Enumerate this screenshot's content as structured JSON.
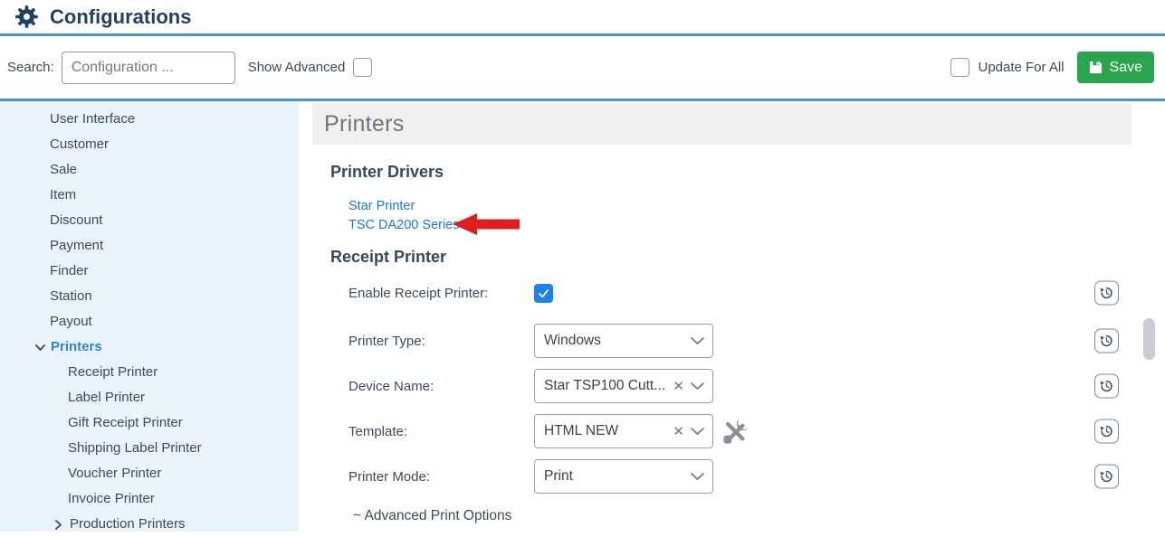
{
  "header": {
    "title": "Configurations"
  },
  "toolbar": {
    "search_label": "Search:",
    "search_placeholder": "Configuration ...",
    "show_advanced_label": "Show Advanced",
    "update_for_all_label": "Update For All",
    "save_label": "Save"
  },
  "sidebar": {
    "items": [
      "User Interface",
      "Customer",
      "Sale",
      "Item",
      "Discount",
      "Payment",
      "Finder",
      "Station",
      "Payout",
      "Printers",
      "Receipt Printer",
      "Label Printer",
      "Gift Receipt Printer",
      "Shipping Label Printer",
      "Voucher Printer",
      "Invoice Printer",
      "Production Printers"
    ]
  },
  "main": {
    "banner_title": "Printers",
    "drivers": {
      "heading": "Printer Drivers",
      "links": [
        "Star Printer",
        "TSC DA200 Series"
      ]
    },
    "receipt": {
      "heading": "Receipt Printer",
      "enable_label": "Enable Receipt Printer:",
      "enable_checked": true,
      "printer_type_label": "Printer Type:",
      "printer_type_value": "Windows",
      "device_name_label": "Device Name:",
      "device_name_value": "Star TSP100 Cutt...",
      "template_label": "Template:",
      "template_value": "HTML NEW",
      "printer_mode_label": "Printer Mode:",
      "printer_mode_value": "Print",
      "advanced_label": "~ Advanced Print Options"
    }
  },
  "colors": {
    "accent_blue": "#4e94c6",
    "link_blue": "#1b78c2",
    "selected_blue": "#2e86c6",
    "save_green": "#2aa44f",
    "checkbox_blue": "#1d83ea",
    "annotation_red": "#e01f1f",
    "sidebar_bg": "#e9f3fb",
    "banner_bg": "#f0f0f0"
  }
}
